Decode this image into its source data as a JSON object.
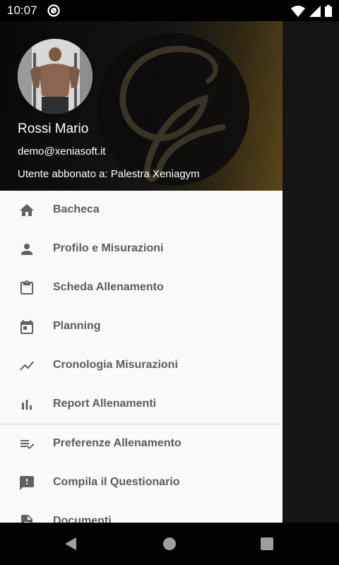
{
  "status_bar": {
    "time": "10:07",
    "icons": [
      "notification-icon",
      "wifi-icon",
      "signal-icon",
      "battery-icon"
    ]
  },
  "drawer": {
    "header": {
      "name": "Rossi Mario",
      "email": "demo@xeniasoft.it",
      "subscription": "Utente abbonato a: Palestra Xeniagym"
    },
    "items": [
      {
        "label": "Bacheca",
        "icon": "home-icon"
      },
      {
        "label": "Profilo e Misurazioni",
        "icon": "person-icon"
      },
      {
        "label": "Scheda Allenamento",
        "icon": "clipboard-icon"
      },
      {
        "label": "Planning",
        "icon": "calendar-icon"
      },
      {
        "label": "Cronologia Misurazioni",
        "icon": "trending-icon"
      },
      {
        "label": "Report Allenamenti",
        "icon": "bar-chart-icon"
      }
    ],
    "secondary_items": [
      {
        "label": "Preferenze Allenamento",
        "icon": "playlist-check-icon"
      },
      {
        "label": "Compila il Questionario",
        "icon": "feedback-icon"
      },
      {
        "label": "Documenti",
        "icon": "document-icon"
      }
    ]
  },
  "colors": {
    "header_accent": "#5a4618",
    "menu_text": "#5c5c5c",
    "menu_icon": "#616161",
    "drawer_bg": "#fafafa"
  },
  "nav_bar": {
    "buttons": [
      "back-icon",
      "home-circle-icon",
      "recents-icon"
    ]
  }
}
